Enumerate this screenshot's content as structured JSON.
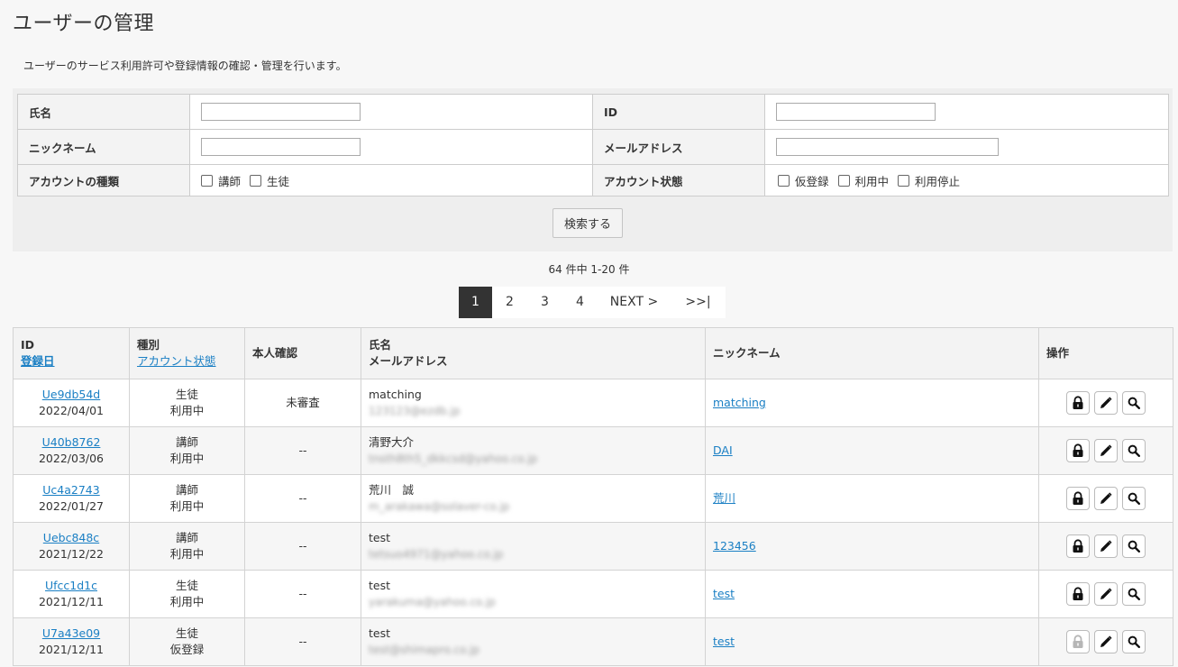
{
  "page": {
    "title": "ユーザーの管理",
    "description": "ユーザーのサービス利用許可や登録情報の確認・管理を行います。"
  },
  "search": {
    "name_label": "氏名",
    "id_label": "ID",
    "nickname_label": "ニックネーム",
    "email_label": "メールアドレス",
    "account_type_label": "アカウントの種類",
    "account_type_options": [
      "講師",
      "生徒"
    ],
    "account_status_label": "アカウント状態",
    "account_status_options": [
      "仮登録",
      "利用中",
      "利用停止"
    ],
    "name_value": "",
    "id_value": "",
    "nickname_value": "",
    "email_value": "",
    "submit_label": "検索する"
  },
  "result_count": "64 件中 1-20 件",
  "pagination": [
    "1",
    "2",
    "3",
    "4",
    "NEXT >",
    ">>|"
  ],
  "table": {
    "headers": {
      "id": "ID",
      "reg_date": "登録日",
      "type": "種別",
      "status": "アカウント状態",
      "verify": "本人確認",
      "name": "氏名",
      "email": "メールアドレス",
      "nickname": "ニックネーム",
      "ops": "操作"
    },
    "rows": [
      {
        "id": "Ue9db54d",
        "date": "2022/04/01",
        "type": "生徒",
        "status": "利用中",
        "verify": "未審査",
        "name": "matching",
        "email": "123123@ezdb.jp",
        "nickname": "matching",
        "lock_disabled": false
      },
      {
        "id": "U40b8762",
        "date": "2022/03/06",
        "type": "講師",
        "status": "利用中",
        "verify": "--",
        "name": "清野大介",
        "email": "tnsth8th5_dkkcsd@yahoo.co.jp",
        "nickname": "DAI",
        "lock_disabled": false
      },
      {
        "id": "Uc4a2743",
        "date": "2022/01/27",
        "type": "講師",
        "status": "利用中",
        "verify": "--",
        "name": "荒川　誠",
        "email": "m_arakawa@solaver-co.jp",
        "nickname": "荒川",
        "lock_disabled": false
      },
      {
        "id": "Uebc848c",
        "date": "2021/12/22",
        "type": "講師",
        "status": "利用中",
        "verify": "--",
        "name": "test",
        "email": "tetsuo4971@yahoo.co.jp",
        "nickname": "123456",
        "lock_disabled": false
      },
      {
        "id": "Ufcc1d1c",
        "date": "2021/12/11",
        "type": "生徒",
        "status": "利用中",
        "verify": "--",
        "name": "test",
        "email": "yarakuma@yahoo.co.jp",
        "nickname": "test",
        "lock_disabled": false
      },
      {
        "id": "U7a43e09",
        "date": "2021/12/11",
        "type": "生徒",
        "status": "仮登録",
        "verify": "--",
        "name": "test",
        "email": "test@shimapro.co.jp",
        "nickname": "test",
        "lock_disabled": true
      }
    ]
  },
  "icons": {
    "lock": "lock-icon",
    "edit": "pencil-icon",
    "view": "magnifier-icon"
  },
  "colors": {
    "link": "#1a7fc4",
    "active_page": "#333333"
  }
}
